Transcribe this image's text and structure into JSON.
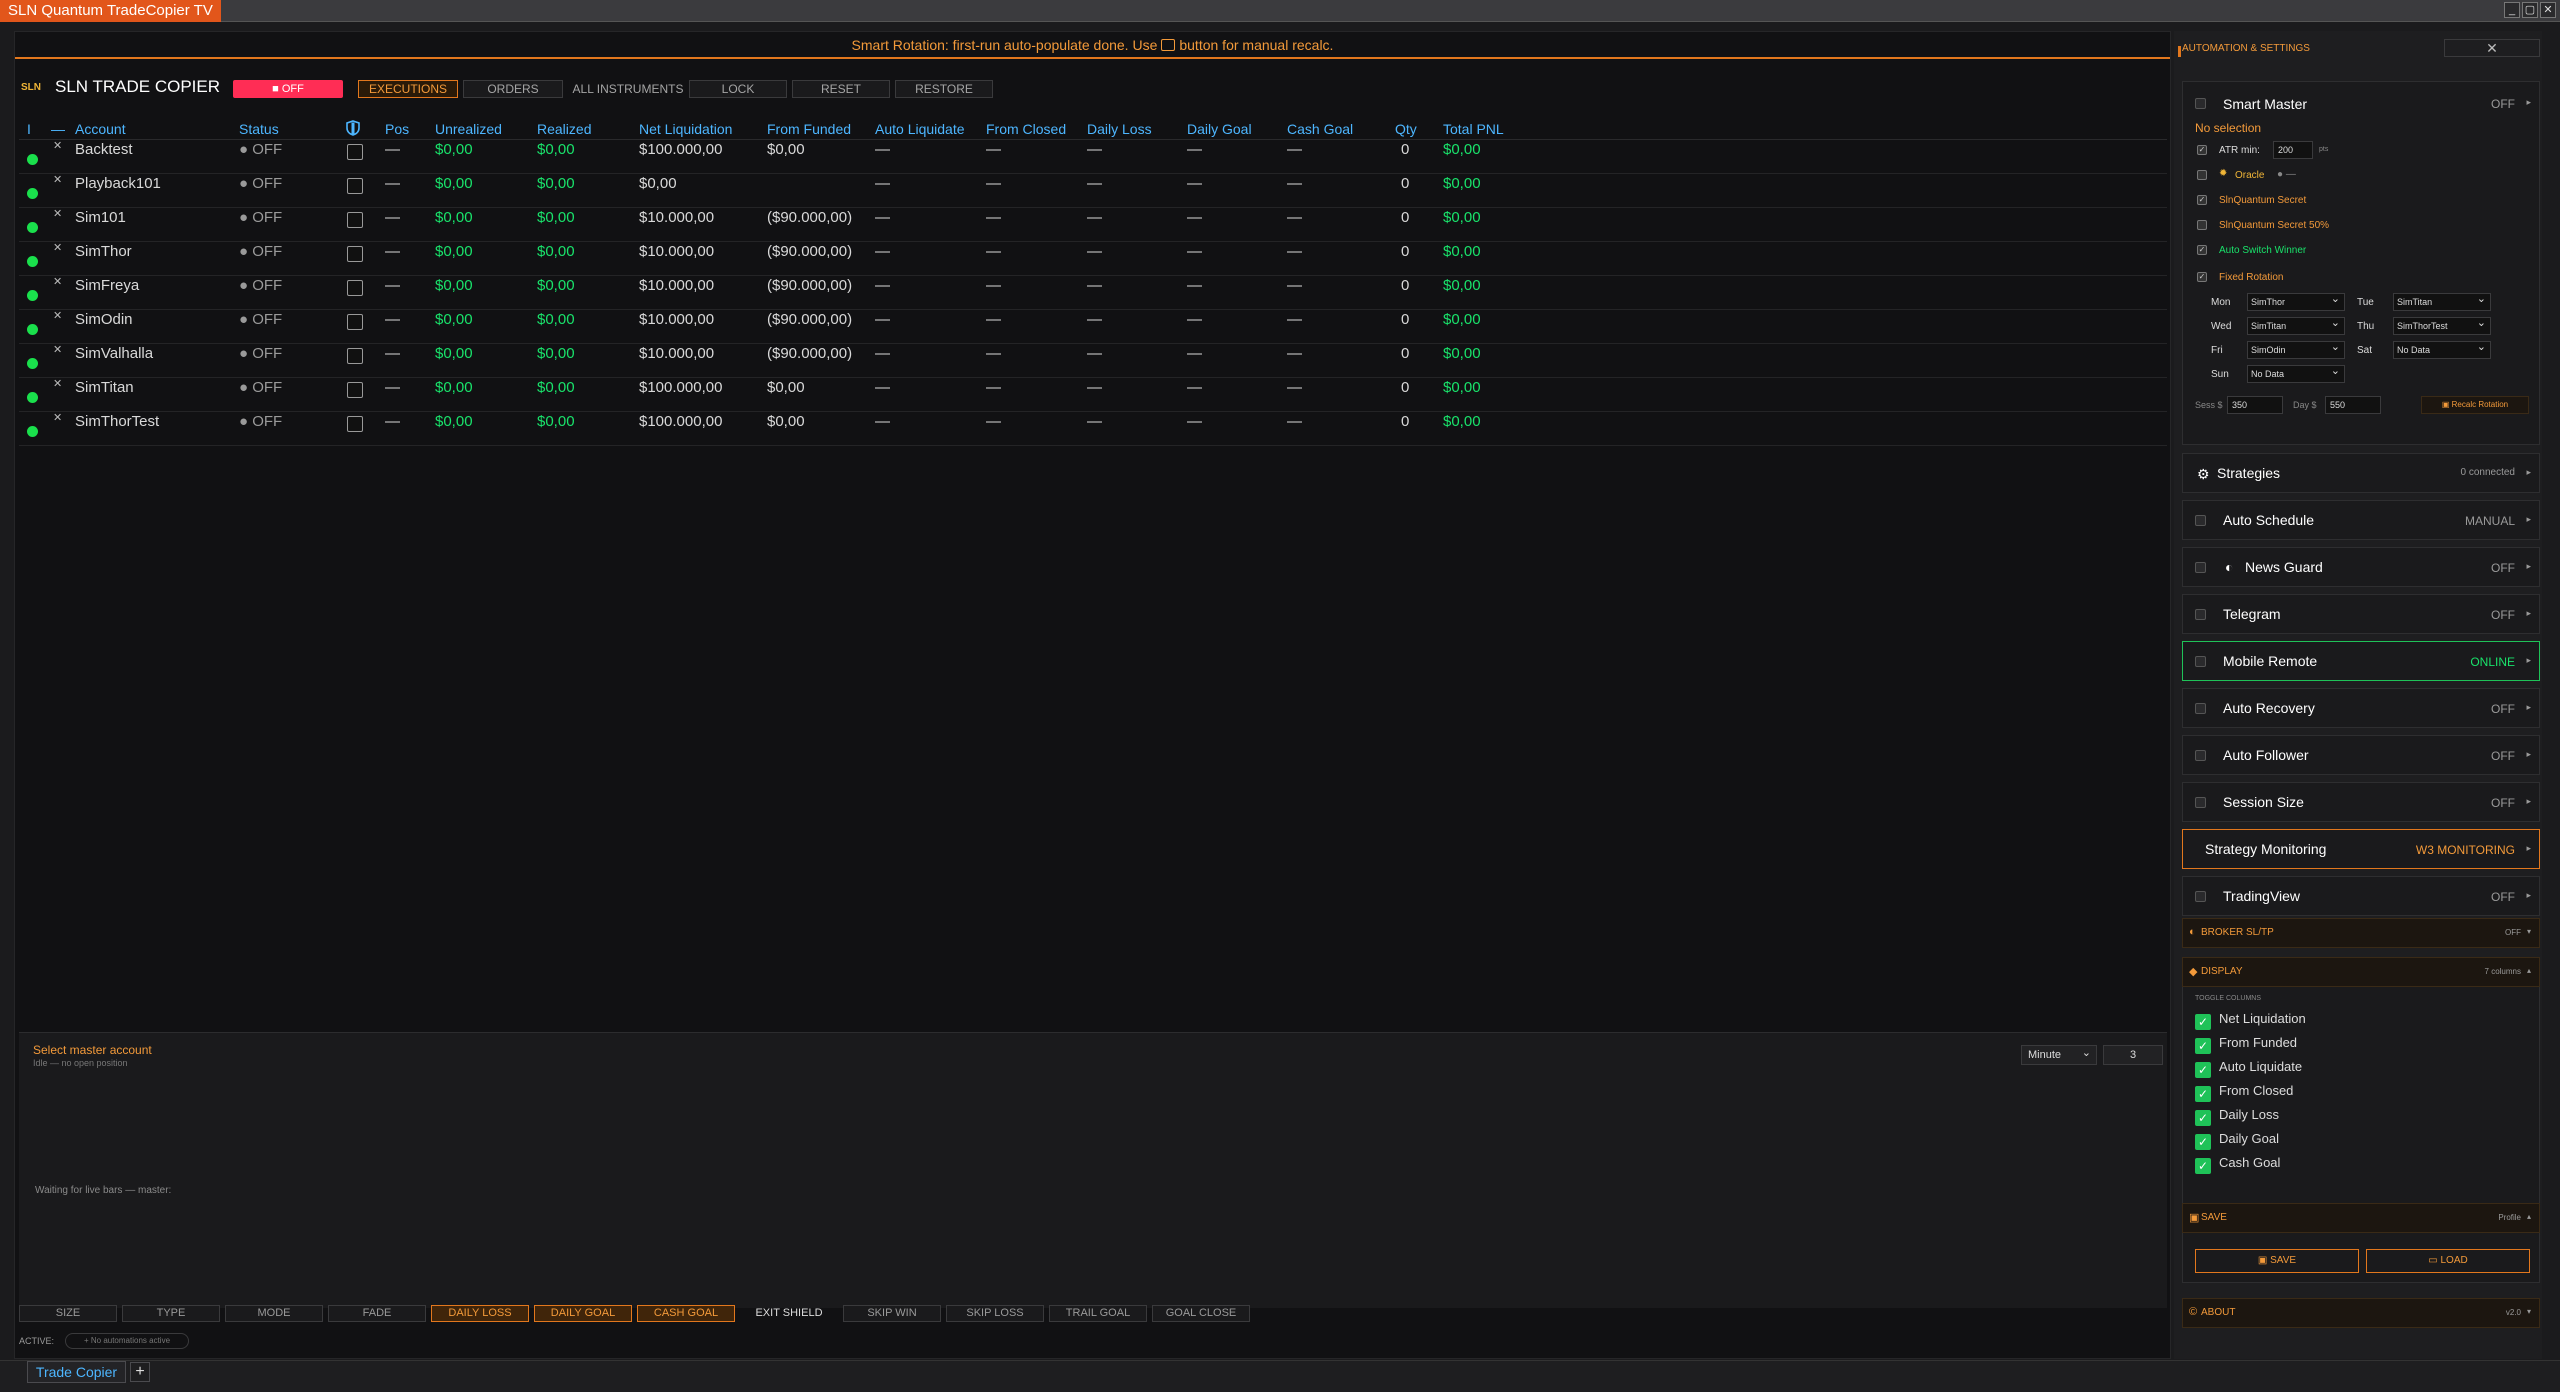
{
  "window": {
    "title": "SLN Quantum TradeCopier TV",
    "controls": [
      "_",
      "▢",
      "✕"
    ]
  },
  "notice": {
    "before": "Smart Rotation: first-run auto-populate done. Use",
    "after": "button for manual recalc."
  },
  "toolbar": {
    "logo": "SLN",
    "brand": "SLN TRADE COPIER",
    "power": "■ OFF",
    "executions": "EXECUTIONS",
    "orders": "ORDERS",
    "instruments": "ALL INSTRUMENTS",
    "lock": "LOCK",
    "reset": "RESET",
    "restore": "RESTORE"
  },
  "grid": {
    "headers": {
      "i": "I",
      "collapse": "—",
      "account": "Account",
      "status": "Status",
      "pos": "Pos",
      "unrealized": "Unrealized",
      "realized": "Realized",
      "netliq": "Net Liquidation",
      "fromfunded": "From Funded",
      "autoliq": "Auto Liquidate",
      "fromclosed": "From Closed",
      "dailyloss": "Daily Loss",
      "dailygoal": "Daily Goal",
      "cashgoal": "Cash Goal",
      "qty": "Qty",
      "totalpnl": "Total PNL"
    },
    "rows": [
      {
        "account": "Backtest",
        "status": "● OFF",
        "pos": "—",
        "unrealized": "$0,00",
        "realized": "$0,00",
        "netliq": "$100.000,00",
        "fromfunded": "$0,00",
        "autoliq": "—",
        "fromclosed": "—",
        "dailyloss": "—",
        "dailygoal": "—",
        "cashgoal": "—",
        "qty": "0",
        "totalpnl": "$0,00"
      },
      {
        "account": "Playback101",
        "status": "● OFF",
        "pos": "—",
        "unrealized": "$0,00",
        "realized": "$0,00",
        "netliq": "$0,00",
        "fromfunded": "",
        "autoliq": "—",
        "fromclosed": "—",
        "dailyloss": "—",
        "dailygoal": "—",
        "cashgoal": "—",
        "qty": "0",
        "totalpnl": "$0,00"
      },
      {
        "account": "Sim101",
        "status": "● OFF",
        "pos": "—",
        "unrealized": "$0,00",
        "realized": "$0,00",
        "netliq": "$10.000,00",
        "fromfunded": "($90.000,00)",
        "autoliq": "—",
        "fromclosed": "—",
        "dailyloss": "—",
        "dailygoal": "—",
        "cashgoal": "—",
        "qty": "0",
        "totalpnl": "$0,00"
      },
      {
        "account": "SimThor",
        "status": "● OFF",
        "pos": "—",
        "unrealized": "$0,00",
        "realized": "$0,00",
        "netliq": "$10.000,00",
        "fromfunded": "($90.000,00)",
        "autoliq": "—",
        "fromclosed": "—",
        "dailyloss": "—",
        "dailygoal": "—",
        "cashgoal": "—",
        "qty": "0",
        "totalpnl": "$0,00"
      },
      {
        "account": "SimFreya",
        "status": "● OFF",
        "pos": "—",
        "unrealized": "$0,00",
        "realized": "$0,00",
        "netliq": "$10.000,00",
        "fromfunded": "($90.000,00)",
        "autoliq": "—",
        "fromclosed": "—",
        "dailyloss": "—",
        "dailygoal": "—",
        "cashgoal": "—",
        "qty": "0",
        "totalpnl": "$0,00"
      },
      {
        "account": "SimOdin",
        "status": "● OFF",
        "pos": "—",
        "unrealized": "$0,00",
        "realized": "$0,00",
        "netliq": "$10.000,00",
        "fromfunded": "($90.000,00)",
        "autoliq": "—",
        "fromclosed": "—",
        "dailyloss": "—",
        "dailygoal": "—",
        "cashgoal": "—",
        "qty": "0",
        "totalpnl": "$0,00"
      },
      {
        "account": "SimValhalla",
        "status": "● OFF",
        "pos": "—",
        "unrealized": "$0,00",
        "realized": "$0,00",
        "netliq": "$10.000,00",
        "fromfunded": "($90.000,00)",
        "autoliq": "—",
        "fromclosed": "—",
        "dailyloss": "—",
        "dailygoal": "—",
        "cashgoal": "—",
        "qty": "0",
        "totalpnl": "$0,00"
      },
      {
        "account": "SimTitan",
        "status": "● OFF",
        "pos": "—",
        "unrealized": "$0,00",
        "realized": "$0,00",
        "netliq": "$100.000,00",
        "fromfunded": "$0,00",
        "autoliq": "—",
        "fromclosed": "—",
        "dailyloss": "—",
        "dailygoal": "—",
        "cashgoal": "—",
        "qty": "0",
        "totalpnl": "$0,00"
      },
      {
        "account": "SimThorTest",
        "status": "● OFF",
        "pos": "—",
        "unrealized": "$0,00",
        "realized": "$0,00",
        "netliq": "$100.000,00",
        "fromfunded": "$0,00",
        "autoliq": "—",
        "fromclosed": "—",
        "dailyloss": "—",
        "dailygoal": "—",
        "cashgoal": "—",
        "qty": "0",
        "totalpnl": "$0,00"
      }
    ]
  },
  "master": {
    "title": "Select master account",
    "sub": "Idle — no open position",
    "timeframe": "Minute",
    "period": "3",
    "waiting": "Waiting for live bars — master:"
  },
  "bottom_buttons": [
    "SIZE",
    "TYPE",
    "MODE",
    "FADE",
    "DAILY LOSS",
    "DAILY GOAL",
    "CASH GOAL",
    "EXIT SHIELD",
    "SKIP WIN",
    "SKIP LOSS",
    "TRAIL GOAL",
    "GOAL CLOSE"
  ],
  "active": {
    "label": "ACTIVE:",
    "pill": "+ No automations active"
  },
  "tabs": {
    "main": "Trade Copier",
    "add": "+"
  },
  "side": {
    "header": "AUTOMATION & SETTINGS",
    "close": "✕",
    "smart_master": {
      "title": "Smart Master",
      "state": "OFF",
      "nosel": "No selection",
      "atr_label": "ATR min:",
      "atr_value": "200",
      "atr_unit": "pts",
      "oracle": "Oracle",
      "oracle_state": "● —",
      "secret": "SlnQuantum Secret",
      "secret50": "SlnQuantum Secret 50%",
      "autoswitch": "Auto Switch Winner",
      "fixed": "Fixed Rotation",
      "days": {
        "mon": "Mon",
        "tue": "Tue",
        "wed": "Wed",
        "thu": "Thu",
        "fri": "Fri",
        "sat": "Sat",
        "sun": "Sun"
      },
      "picks": {
        "mon": "SimThor",
        "tue": "SimTitan",
        "wed": "SimTitan",
        "thu": "SimThorTest",
        "fri": "SimOdin",
        "sat": "No Data",
        "sun": "No Data"
      },
      "sess_label": "Sess $",
      "sess_value": "350",
      "day_label": "Day $",
      "day_value": "550",
      "recalc": "Recalc Rotation"
    },
    "cards": [
      {
        "title": "Strategies",
        "state": "0 connected"
      },
      {
        "title": "Auto Schedule",
        "state": "MANUAL"
      },
      {
        "title": "News Guard",
        "state": "OFF"
      },
      {
        "title": "Telegram",
        "state": "OFF"
      },
      {
        "title": "Mobile Remote",
        "state": "ONLINE"
      },
      {
        "title": "Auto Recovery",
        "state": "OFF"
      },
      {
        "title": "Auto Follower",
        "state": "OFF"
      },
      {
        "title": "Session Size",
        "state": "OFF"
      },
      {
        "title": "Strategy Monitoring",
        "state": "W3 MONITORING"
      },
      {
        "title": "TradingView",
        "state": "OFF"
      }
    ],
    "broker": {
      "title": "BROKER SL/TP",
      "state": "OFF"
    },
    "display": {
      "title": "DISPLAY",
      "state": "7 columns",
      "toggle": "TOGGLE COLUMNS",
      "columns": [
        "Net Liquidation",
        "From Funded",
        "Auto Liquidate",
        "From Closed",
        "Daily Loss",
        "Daily Goal",
        "Cash Goal"
      ]
    },
    "save": {
      "title": "SAVE",
      "state": "Profile",
      "save_btn": "SAVE",
      "load_btn": "LOAD"
    },
    "about": {
      "title": "ABOUT",
      "state": "v2.0"
    }
  },
  "colors": {
    "accent": "#e2771d",
    "green": "#19e36b",
    "blue": "#4db6ff",
    "red": "#ff2d55"
  }
}
